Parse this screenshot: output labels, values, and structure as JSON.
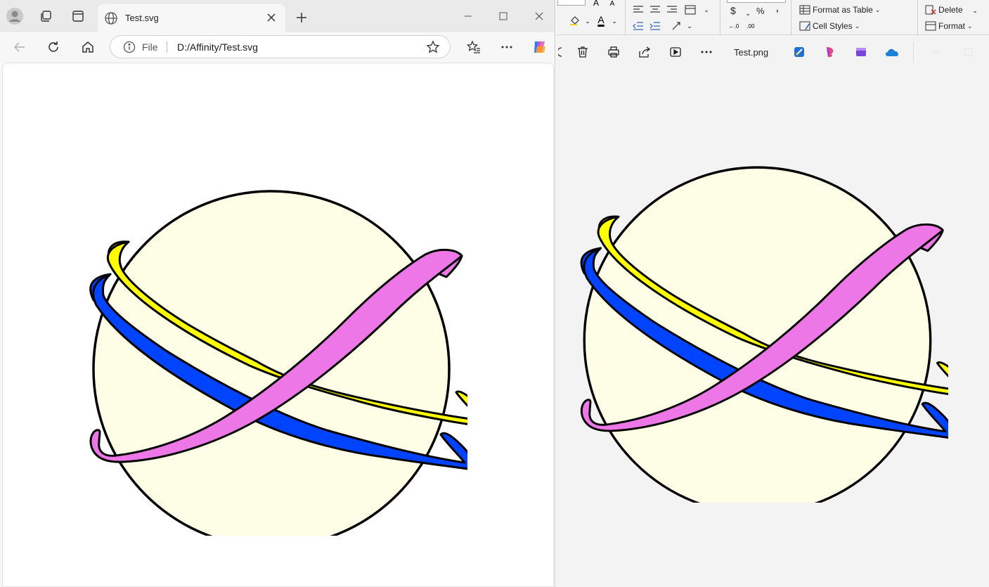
{
  "browser": {
    "tab_title": "Test.svg",
    "address_prefix": "File",
    "address_url": "D:/Affinity/Test.svg"
  },
  "ribbon": {
    "currency_symbol": "$",
    "percent_symbol": "%",
    "comma_symbol": "‚",
    "format_as_table": "Format as Table",
    "cell_styles": "Cell Styles",
    "delete": "Delete",
    "format": "Format"
  },
  "photos": {
    "file_name": "Test.png"
  },
  "colors": {
    "planet_fill": "#fefde6",
    "ring_yellow": "#ffff00",
    "ring_blue": "#0044ff",
    "ring_pink": "#ee77e8",
    "outline": "#000000"
  }
}
